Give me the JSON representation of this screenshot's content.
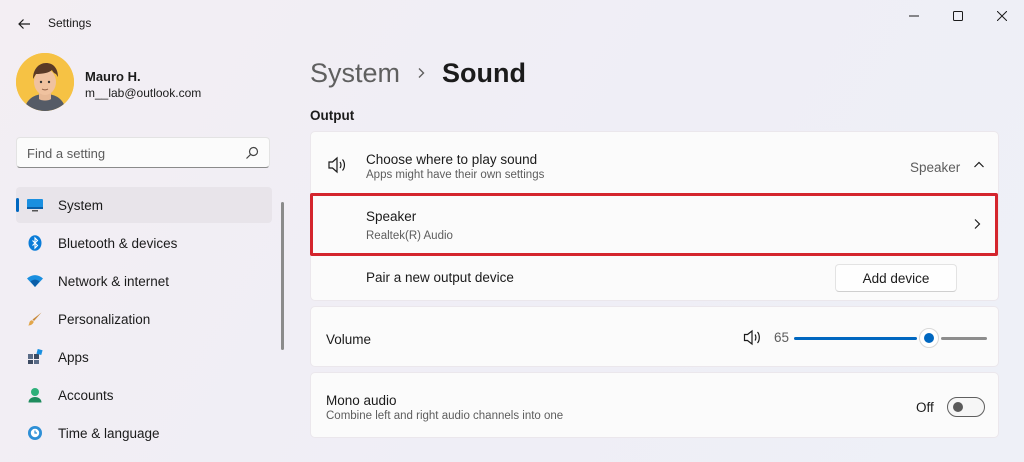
{
  "window": {
    "title": "Settings"
  },
  "profile": {
    "name": "Mauro H.",
    "email": "m__lab@outlook.com"
  },
  "search": {
    "placeholder": "Find a setting"
  },
  "nav": {
    "items": [
      {
        "label": "System",
        "icon": "system-monitor-icon",
        "active": true
      },
      {
        "label": "Bluetooth & devices",
        "icon": "bluetooth-icon"
      },
      {
        "label": "Network & internet",
        "icon": "wifi-icon"
      },
      {
        "label": "Personalization",
        "icon": "paintbrush-icon"
      },
      {
        "label": "Apps",
        "icon": "apps-icon"
      },
      {
        "label": "Accounts",
        "icon": "account-icon"
      },
      {
        "label": "Time & language",
        "icon": "globe-clock-icon"
      }
    ]
  },
  "breadcrumb": {
    "parent": "System",
    "current": "Sound"
  },
  "output": {
    "section_title": "Output",
    "choose": {
      "title": "Choose where to play sound",
      "subtitle": "Apps might have their own settings",
      "value": "Speaker"
    },
    "device": {
      "name": "Speaker",
      "description": "Realtek(R) Audio"
    },
    "pair": {
      "label": "Pair a new output device",
      "button": "Add device"
    },
    "volume": {
      "label": "Volume",
      "value": "65",
      "level": 0.65
    },
    "mono": {
      "title": "Mono audio",
      "subtitle": "Combine left and right audio channels into one",
      "state": "Off"
    }
  },
  "colors": {
    "accent": "#0067c0",
    "highlight": "#d4252d"
  }
}
